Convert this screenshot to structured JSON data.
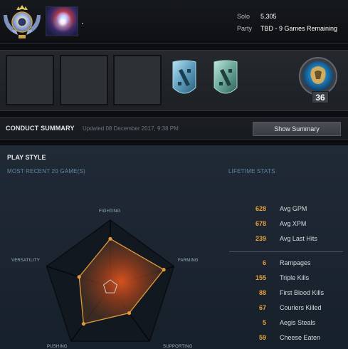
{
  "header": {
    "player_name": ".",
    "rank_medal_icon": "divine-rank-medal-icon",
    "avatar_icon": "player-avatar-icon",
    "mmr": [
      {
        "label": "Solo",
        "value": "5,305"
      },
      {
        "label": "Party",
        "value": "TBD - 9 Games Remaining"
      }
    ]
  },
  "showcase": {
    "slots": [
      "empty-slot",
      "empty-slot",
      "empty-slot"
    ],
    "badges": [
      "dota-badge-icon",
      "dota-badge-icon"
    ],
    "level": "36",
    "level_icon": "battle-pass-level-icon"
  },
  "conduct": {
    "title": "CONDUCT SUMMARY",
    "updated": "Updated 08 December 2017, 9:38 PM",
    "button": "Show Summary"
  },
  "playstyle": {
    "title": "PLAY STYLE",
    "recent_label": "MOST RECENT 20 GAME(S)",
    "lifetime_label": "LIFETIME STATS",
    "radar": {
      "axes": [
        "FIGHTING",
        "FARMING",
        "SUPPORTING",
        "PUSHING",
        "VERSATILITY"
      ],
      "values": [
        0.72,
        0.84,
        0.48,
        0.68,
        0.49
      ],
      "fill_color": "#e09a3c"
    },
    "averages": [
      {
        "value": "628",
        "label": "Avg GPM"
      },
      {
        "value": "678",
        "label": "Avg XPM"
      },
      {
        "value": "239",
        "label": "Avg Last Hits"
      }
    ],
    "totals": [
      {
        "value": "6",
        "label": "Rampages"
      },
      {
        "value": "155",
        "label": "Triple Kills"
      },
      {
        "value": "88",
        "label": "First Blood Kills"
      },
      {
        "value": "67",
        "label": "Couriers Killed"
      },
      {
        "value": "5",
        "label": "Aegis Steals"
      },
      {
        "value": "59",
        "label": "Cheese Eaten"
      }
    ]
  },
  "colors": {
    "accent": "#e6a23c",
    "subheader": "#5f89a8",
    "background": "#0b0d10"
  }
}
